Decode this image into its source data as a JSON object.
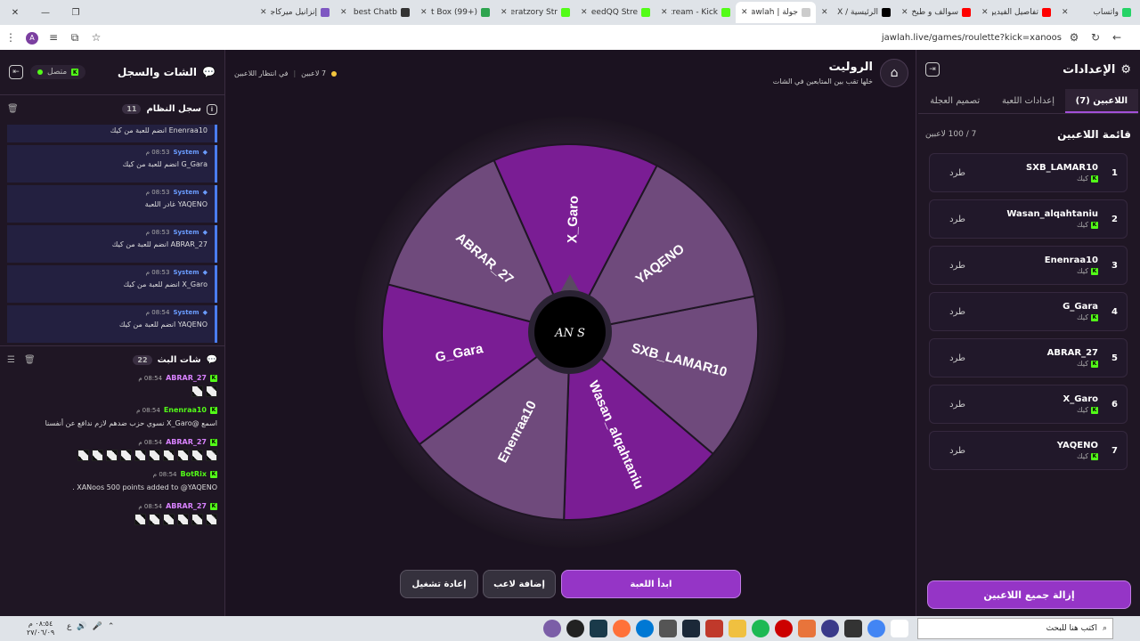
{
  "browser": {
    "tabs": [
      {
        "label": "واتساب",
        "color": "#25d366"
      },
      {
        "label": "تفاصيل الفيديو",
        "color": "#ff0000"
      },
      {
        "label": "سوالف و طبخ",
        "color": "#ff0000"
      },
      {
        "label": "الرئيسية / X",
        "color": "#000000"
      },
      {
        "label": "جولة | Jawlah",
        "color": "#cccccc",
        "active": true
      },
      {
        "label": "Stream - Kick",
        "color": "#53fc18"
      },
      {
        "label": "YazeedQQ Stre",
        "color": "#53fc18"
      },
      {
        "label": "Alneratzory Str",
        "color": "#53fc18"
      },
      {
        "label": "Alert Box (99+)",
        "color": "#2ea44f"
      },
      {
        "label": "The best Chatb",
        "color": "#333333"
      },
      {
        "label": "إنزانيل ميركاجو",
        "color": "#7e57c2"
      }
    ],
    "url": "jawlah.live/games/roulette?kick=xanoos",
    "profile_initial": "A"
  },
  "chat": {
    "title": "الشات والسجل",
    "connection": "متصل",
    "system_log": {
      "title": "سجل النظام",
      "count": "11",
      "items": [
        {
          "sender": "",
          "time": "",
          "text": "Enenraa10 انضم للعبة من كيك"
        },
        {
          "sender": "System",
          "time": "08:53 م",
          "text": "G_Gara انضم للعبة من كيك"
        },
        {
          "sender": "System",
          "time": "08:53 م",
          "text": "YAQENO غادر اللعبة"
        },
        {
          "sender": "System",
          "time": "08:53 م",
          "text": "ABRAR_27 انضم للعبة من كيك"
        },
        {
          "sender": "System",
          "time": "08:53 م",
          "text": "X_Garo انضم للعبة من كيك"
        },
        {
          "sender": "System",
          "time": "08:54 م",
          "text": "YAQENO انضم للعبة من كيك"
        }
      ]
    },
    "live_chat": {
      "title": "شات البث",
      "count": "22",
      "messages": [
        {
          "user": "ABRAR_27",
          "time": "08:54 م",
          "color": "#d982ff",
          "text": "",
          "emotes": 2
        },
        {
          "user": "Enenraa10",
          "time": "08:54 م",
          "color": "#53fc18",
          "text": "اسمع @X_Garo نسوي حزب ضدهم لازم ندافع عن أنفسنا",
          "emotes": 0
        },
        {
          "user": "ABRAR_27",
          "time": "08:54 م",
          "color": "#d982ff",
          "text": "",
          "emotes": 10
        },
        {
          "user": "BotRix",
          "time": "08:54 م",
          "color": "#53fc18",
          "text": "XANoos 500 points added to @YAQENO .",
          "emotes": 0
        },
        {
          "user": "ABRAR_27",
          "time": "08:54 م",
          "color": "#d982ff",
          "text": "",
          "emotes": 6
        }
      ]
    }
  },
  "game": {
    "title": "الروليت",
    "subtitle": "خلها تقب بين المتابعين في الشات",
    "player_count_label": "7 لاعبين",
    "waiting_label": "في انتظار اللاعبين",
    "center_logo_text": "AN  S",
    "buttons": {
      "start": "ابدأ اللعبة",
      "add": "إضافة لاعب",
      "restart": "إعادة تشغيل"
    }
  },
  "chart_data": {
    "type": "pie",
    "categories": [
      "SXB_LAMAR10",
      "Wasan_alqahtaniu",
      "Enenraa10",
      "G_Gara",
      "ABRAR_27",
      "X_Garo",
      "YAQENO"
    ],
    "values": [
      1,
      1,
      1,
      1,
      1,
      1,
      1
    ],
    "colors": [
      "#6f4a7c",
      "#7a1d94",
      "#6f4a7c",
      "#7a1d94",
      "#6f4a7c",
      "#7a1d94",
      "#6f4a7c"
    ]
  },
  "settings": {
    "title": "الإعدادات",
    "tabs": [
      "اللاعبين (7)",
      "إعدادات اللعبة",
      "تصميم العجلة"
    ],
    "player_list_title": "قائمة اللاعبين",
    "player_count": "7 / 100 لاعبين",
    "players": [
      {
        "num": "1",
        "name": "SXB_LAMAR10",
        "platform": "كيك"
      },
      {
        "num": "2",
        "name": "Wasan_alqahtaniu",
        "platform": "كيك"
      },
      {
        "num": "3",
        "name": "Enenraa10",
        "platform": "كيك"
      },
      {
        "num": "4",
        "name": "G_Gara",
        "platform": "كيك"
      },
      {
        "num": "5",
        "name": "ABRAR_27",
        "platform": "كيك"
      },
      {
        "num": "6",
        "name": "X_Garo",
        "platform": "كيك"
      },
      {
        "num": "7",
        "name": "YAQENO",
        "platform": "كيك"
      }
    ],
    "kick_label": "طرد",
    "clear_all": "إزالة جميع اللاعبين"
  },
  "taskbar": {
    "search_placeholder": "اكتب هنا للبحث",
    "time": "٠٨:٥٤ م",
    "date": "٢٧/٠٦/٠٩",
    "lang": "ع"
  }
}
